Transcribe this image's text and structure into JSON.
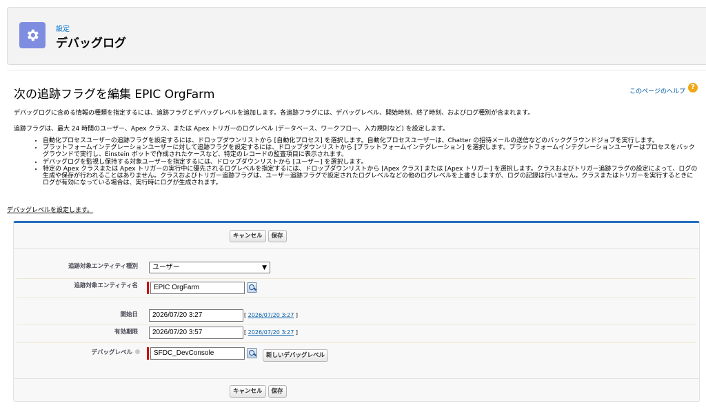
{
  "header": {
    "subtitle": "設定",
    "title": "デバッグログ",
    "icon": "gear-icon"
  },
  "page": {
    "title": "次の追跡フラグを編集 EPIC OrgFarm",
    "help_link": "このページのヘルプ",
    "help_icon": "?",
    "intro1": "デバッグログに含める情報の種類を指定するには、追跡フラグとデバッグレベルを追加します。各追跡フラグには、デバッグレベル、開始時刻、終了時刻、およびログ種別が含まれます。",
    "intro2": "追跡フラグは、最大 24 時間のユーザー、Apex クラス、または Apex トリガーのログレベル (データベース、ワークフロー、入力規則など) を設定します。",
    "bullets": [
      "自動化プロセスユーザーの追跡フラグを設定するには、ドロップダウンリストから [自動化プロセス] を選択します。自動化プロセスユーザーは、Chatter の招待メールの送信などのバックグラウンドジョブを実行します。",
      "プラットフォームインテグレーションユーザーに対して追跡フラグを設定するには、ドロップダウンリストから [プラットフォームインテグレーション] を選択します。プラットフォームインテグレーションユーザーはプロセスをバックグラウンドで実行し、Einstein ボットで作成されたケースなど、特定のレコードの監査項目に表示されます。",
      "デバッグログを監視し保持する対象ユーザーを指定するには、ドロップダウンリストから [ユーザー] を選択します。",
      "特定の Apex クラスまたは Apex トリガーの実行中に優先されるログレベルを指定するには、ドロップダウンリストから [Apex クラス] または [Apex トリガー] を選択します。クラスおよびトリガー追跡フラグの設定によって、ログの生成や保存が行われることはありません。クラスおよびトリガー追跡フラグは、ユーザー追跡フラグで設定されたログレベルなどの他のログレベルを上書きしますが、ログの記録は行いません。クラスまたはトリガーを実行するときにログが有効になっている場合は、実行時にログが生成されます。"
    ],
    "set_level_link": "デバッグレベルを設定します。"
  },
  "form": {
    "cancel_label": "キャンセル",
    "save_label": "保存",
    "entity_type_label": "追跡対象エンティティ種別",
    "entity_type_value": "ユーザー",
    "entity_name_label": "追跡対象エンティティ名",
    "entity_name_value": "EPIC OrgFarm",
    "start_label": "開始日",
    "start_value": "2026/07/20 3:27",
    "start_today_link": "2026/07/20 3:27",
    "expire_label": "有効期限",
    "expire_value": "2026/07/20 3:57",
    "expire_today_link": "2026/07/20 3:27",
    "debug_level_label": "デバッグレベル",
    "debug_level_value": "SFDC_DevConsole",
    "new_debug_level_button": "新しいデバッグレベル",
    "bracket_open": "[",
    "bracket_close": "]"
  },
  "colors": {
    "accent": "#236fbd",
    "header_icon": "#7f8de1",
    "required": "#cc0000",
    "link": "#015ba7"
  }
}
